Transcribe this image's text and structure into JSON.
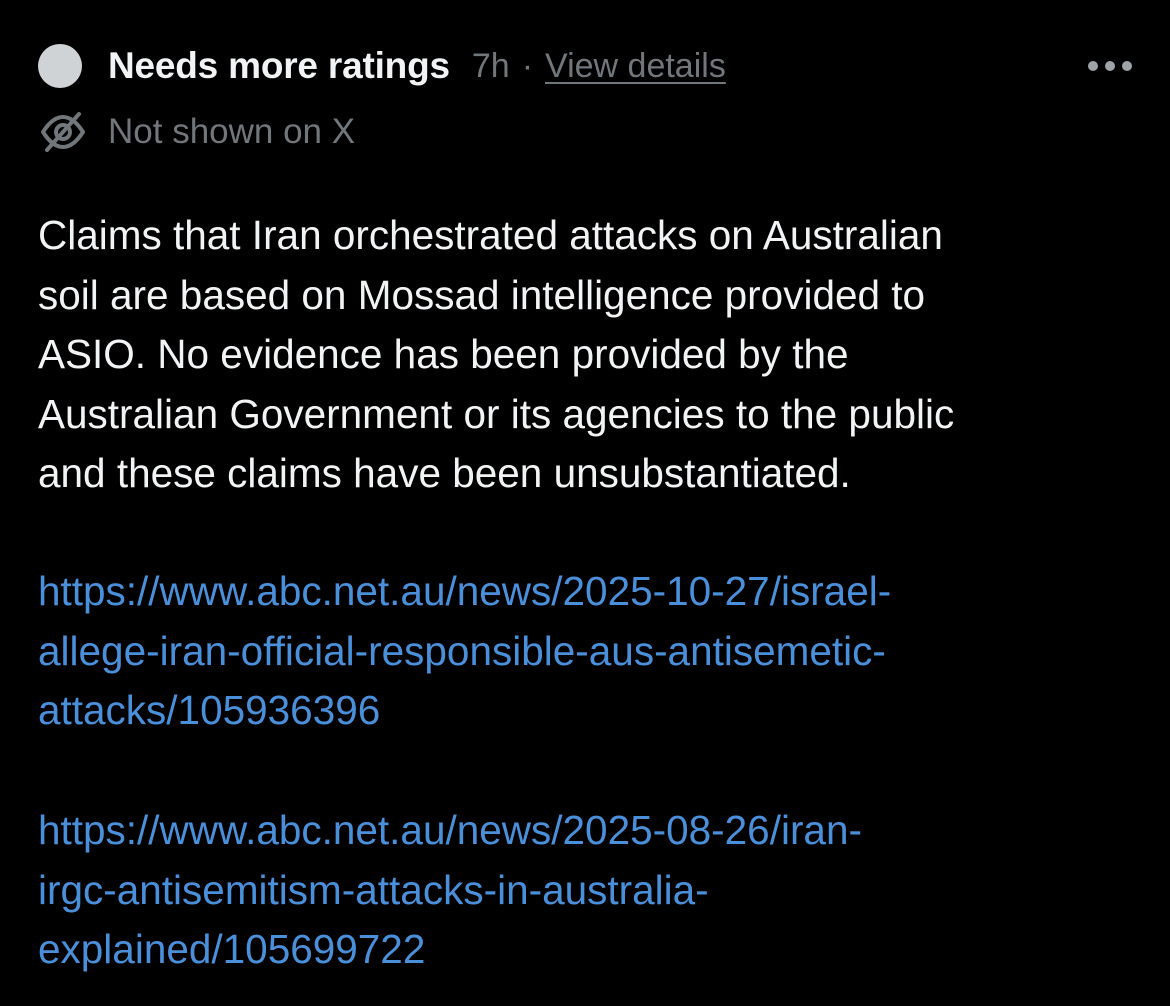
{
  "header": {
    "title": "Needs more ratings",
    "time": "7h",
    "separator": "·",
    "view_details_label": "View details",
    "more_icon": "more-horizontal-icon",
    "more_label": "•••"
  },
  "status": {
    "icon": "eye-off-icon",
    "text": "Not shown on X"
  },
  "note": {
    "text": "Claims that Iran orchestrated attacks on Australian\nsoil are based on Mossad intelligence provided to\nASIO. No evidence has been provided by the\nAustralian Government or its agencies to the public\nand these claims have been unsubstantiated."
  },
  "links": [
    {
      "text": "https://www.abc.net.au/news/2025-10-27/israel-\nallege-iran-official-responsible-aus-antisemetic-\nattacks/105936396"
    },
    {
      "text": "https://www.abc.net.au/news/2025-08-26/iran-\nirgc-antisemitism-attacks-in-australia-\nexplained/105699722"
    }
  ],
  "colors": {
    "background": "#000000",
    "primary_text": "#f1f3f4",
    "secondary_text": "#71767b",
    "link": "#4a8fd9",
    "status_dot": "#cfd3d6"
  }
}
